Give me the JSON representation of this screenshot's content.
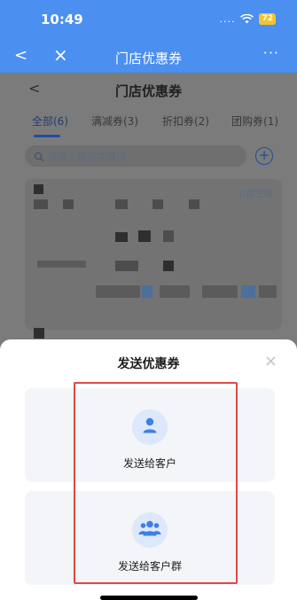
{
  "status_bar": {
    "time": "10:49",
    "signal": "....",
    "battery": "72"
  },
  "app_bar": {
    "back_icon": "chevron-left-icon",
    "close_icon": "close-icon",
    "title": "门店优惠券",
    "more": "···"
  },
  "page": {
    "back": "<",
    "title": "门店优惠券",
    "tabs": [
      {
        "label": "全部(6)",
        "active": true
      },
      {
        "label": "满减券(3)"
      },
      {
        "label": "折扣券(2)"
      },
      {
        "label": "团购券(1)"
      }
    ],
    "search": {
      "placeholder": "请输入搜索关键词"
    },
    "card": {
      "status": "立即生效"
    }
  },
  "sheet": {
    "title": "发送优惠券",
    "close": "×",
    "options": [
      {
        "label": "发送给客户",
        "icon": "person-icon"
      },
      {
        "label": "发送给客户群",
        "icon": "group-icon"
      }
    ]
  },
  "colors": {
    "accent": "#4b8ff0",
    "highlight": "#e04848",
    "icon_blue": "#3e7ee8"
  }
}
